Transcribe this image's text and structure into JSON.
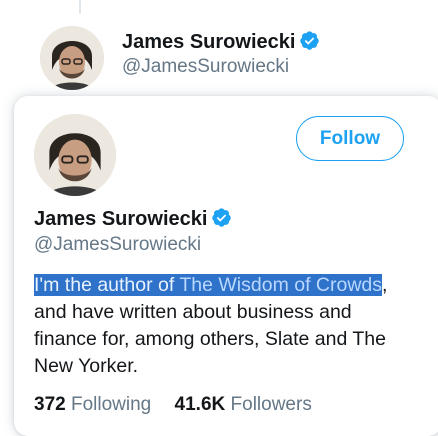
{
  "background_profile": {
    "name": "James Surowiecki",
    "handle": "@JamesSurowiecki"
  },
  "hover_card": {
    "name": "James Surowiecki",
    "handle": "@JamesSurowiecki",
    "follow_label": "Follow",
    "bio": {
      "selected_prefix": "I'm the author of ",
      "link_text": "The Wisdom of Crowds",
      "rest": ", and have written about business and finance for, among others, Slate and The New Yorker."
    },
    "stats": {
      "following_count": "372",
      "following_label": "Following",
      "followers_count": "41.6K",
      "followers_label": "Followers"
    }
  },
  "edge_glyphs": [
    "(",
    "ɿ"
  ],
  "colors": {
    "accent": "#1da1f2",
    "verified": "#1da1f2",
    "text_secondary": "#657786",
    "selection": "#2f72c9"
  },
  "icons": [
    "avatar",
    "verified-badge-icon"
  ]
}
